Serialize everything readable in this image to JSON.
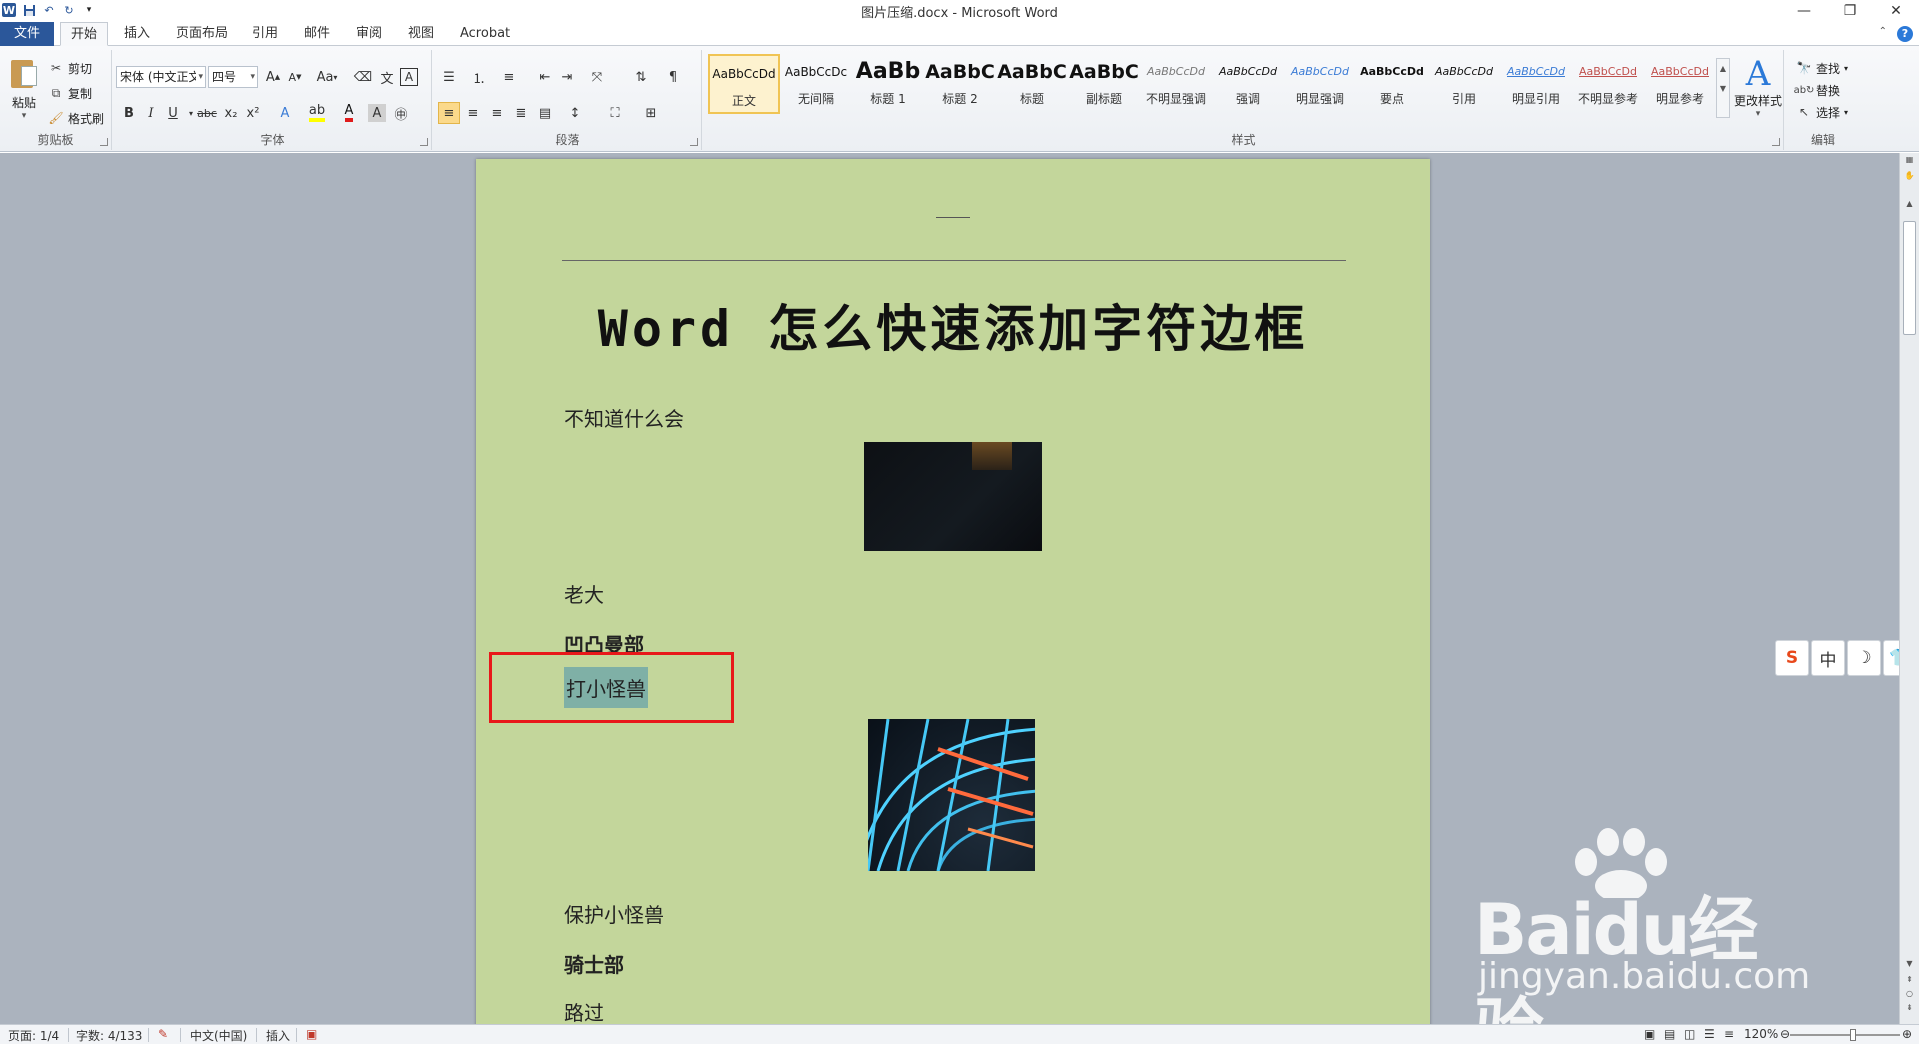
{
  "window": {
    "title": "图片压缩.docx - Microsoft Word"
  },
  "tabs": [
    {
      "label": "文件"
    },
    {
      "label": "开始"
    },
    {
      "label": "插入"
    },
    {
      "label": "页面布局"
    },
    {
      "label": "引用"
    },
    {
      "label": "邮件"
    },
    {
      "label": "审阅"
    },
    {
      "label": "视图"
    },
    {
      "label": "Acrobat"
    }
  ],
  "ribbon": {
    "clipboard": {
      "label": "剪贴板",
      "paste": "粘贴",
      "cut": "剪切",
      "copy": "复制",
      "format_painter": "格式刷"
    },
    "font": {
      "label": "字体",
      "font_name": "宋体 (中文正文)",
      "font_size": "四号",
      "change_case": "Aa"
    },
    "paragraph": {
      "label": "段落"
    },
    "styles": {
      "label": "样式",
      "change_styles": "更改样式",
      "items": [
        {
          "sample": "AaBbCcDd",
          "name": "正文"
        },
        {
          "sample": "AaBbCcDc",
          "name": "无间隔"
        },
        {
          "sample": "AaBb",
          "name": "标题 1"
        },
        {
          "sample": "AaBbC",
          "name": "标题 2"
        },
        {
          "sample": "AaBbC",
          "name": "标题"
        },
        {
          "sample": "AaBbC",
          "name": "副标题"
        },
        {
          "sample": "AaBbCcDd",
          "name": "不明显强调"
        },
        {
          "sample": "AaBbCcDd",
          "name": "强调"
        },
        {
          "sample": "AaBbCcDd",
          "name": "明显强调"
        },
        {
          "sample": "AaBbCcDd",
          "name": "要点"
        },
        {
          "sample": "AaBbCcDd",
          "name": "引用"
        },
        {
          "sample": "AaBbCcDd",
          "name": "明显引用"
        },
        {
          "sample": "AaBbCcDd",
          "name": "不明显参考"
        },
        {
          "sample": "AaBbCcDd",
          "name": "明显参考"
        }
      ]
    },
    "editing": {
      "label": "编辑",
      "find": "查找",
      "replace": "替换",
      "select": "选择"
    }
  },
  "document": {
    "header_mark": "—",
    "title": "Word 怎么快速添加字符边框",
    "paragraphs": [
      {
        "text": "不知道什么会"
      },
      {
        "text": "老大"
      },
      {
        "text": "凹凸曼部"
      },
      {
        "text": "打小怪兽"
      },
      {
        "text": "保护小怪兽"
      },
      {
        "text": "骑士部"
      },
      {
        "text": "路过"
      }
    ]
  },
  "statusbar": {
    "page": "页面: 1/4",
    "words": "字数: 4/133",
    "language": "中文(中国)",
    "mode": "插入",
    "zoom": "120%"
  },
  "ime_toolbar": {
    "mode": "中"
  },
  "watermark": {
    "brand": "Baidu经验",
    "url": "jingyan.baidu.com"
  },
  "colors": {
    "page_background": "#c3d69b",
    "selection_highlight": "#7fb0a6",
    "annotation_box": "#e8181a",
    "file_tab": "#2b579a"
  }
}
